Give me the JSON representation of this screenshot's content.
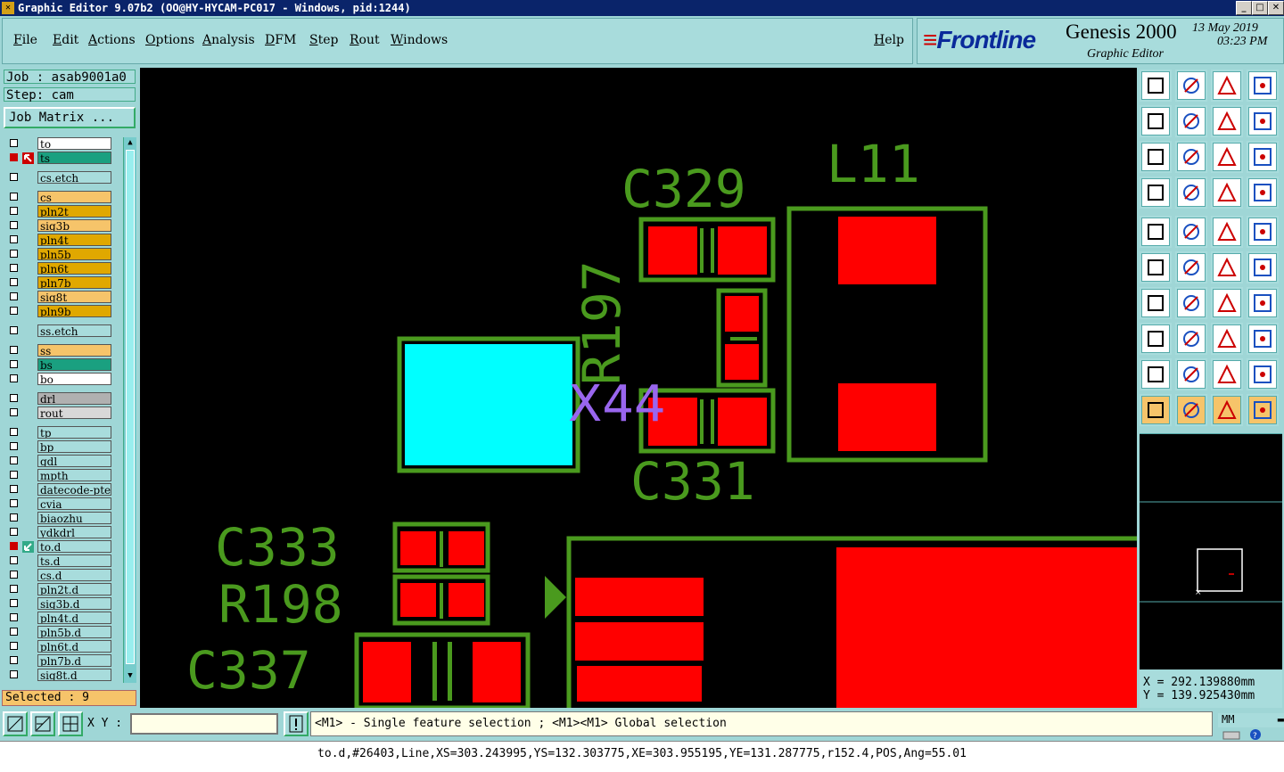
{
  "window": {
    "title": "Graphic Editor 9.07b2 (OO@HY-HYCAM-PC017 - Windows, pid:1244)"
  },
  "menu": [
    "File",
    "Edit",
    "Actions",
    "Options",
    "Analysis",
    "DFM",
    "Step",
    "Rout",
    "Windows"
  ],
  "help_label": "Help",
  "brand": {
    "logo": "Frontline",
    "product": "Genesis 2000",
    "subtitle": "Graphic Editor",
    "date": "13 May 2019",
    "time": "03:23 PM"
  },
  "job": {
    "label": "Job : asab9001a0",
    "step": "Step: cam",
    "matrix_button": "Job Matrix ..."
  },
  "layers": [
    {
      "name": "to",
      "color": "#ffffff",
      "checked": false
    },
    {
      "name": "ts",
      "color": "#1aa080",
      "checked": true,
      "active": true
    },
    {
      "name": "cs.etch",
      "color": "#a8dcdc",
      "checked": false
    },
    {
      "name": "cs",
      "color": "#f6c46a",
      "checked": false
    },
    {
      "name": "pln2t",
      "color": "#e0a800",
      "checked": false
    },
    {
      "name": "sig3b",
      "color": "#f6c46a",
      "checked": false
    },
    {
      "name": "pln4t",
      "color": "#e0a800",
      "checked": false
    },
    {
      "name": "pln5b",
      "color": "#e0a800",
      "checked": false
    },
    {
      "name": "pln6t",
      "color": "#e0a800",
      "checked": false
    },
    {
      "name": "pln7b",
      "color": "#e0a800",
      "checked": false
    },
    {
      "name": "sig8t",
      "color": "#f6c46a",
      "checked": false
    },
    {
      "name": "pln9b",
      "color": "#e0a800",
      "checked": false
    },
    {
      "name": "ss.etch",
      "color": "#a8dcdc",
      "checked": false
    },
    {
      "name": "ss",
      "color": "#f6c46a",
      "checked": false
    },
    {
      "name": "bs",
      "color": "#1aa080",
      "checked": false
    },
    {
      "name": "bo",
      "color": "#ffffff",
      "checked": false
    },
    {
      "name": "drl",
      "color": "#b0b0b0",
      "checked": false
    },
    {
      "name": "rout",
      "color": "#d8d8d8",
      "checked": false
    },
    {
      "name": "tp",
      "color": "#a8dcdc",
      "checked": false
    },
    {
      "name": "bp",
      "color": "#a8dcdc",
      "checked": false
    },
    {
      "name": "gdl",
      "color": "#a8dcdc",
      "checked": false
    },
    {
      "name": "mpth",
      "color": "#a8dcdc",
      "checked": false
    },
    {
      "name": "datecode-pte",
      "color": "#a8dcdc",
      "checked": false
    },
    {
      "name": "cvia",
      "color": "#a8dcdc",
      "checked": false
    },
    {
      "name": "biaozhu",
      "color": "#a8dcdc",
      "checked": false
    },
    {
      "name": "ydkdrl",
      "color": "#a8dcdc",
      "checked": false
    },
    {
      "name": "to.d",
      "color": "#a8dcdc",
      "checked": true,
      "affected": true
    },
    {
      "name": "ts.d",
      "color": "#a8dcdc",
      "checked": false
    },
    {
      "name": "cs.d",
      "color": "#a8dcdc",
      "checked": false
    },
    {
      "name": "pln2t.d",
      "color": "#a8dcdc",
      "checked": false
    },
    {
      "name": "sig3b.d",
      "color": "#a8dcdc",
      "checked": false
    },
    {
      "name": "pln4t.d",
      "color": "#a8dcdc",
      "checked": false
    },
    {
      "name": "pln5b.d",
      "color": "#a8dcdc",
      "checked": false
    },
    {
      "name": "pln6t.d",
      "color": "#a8dcdc",
      "checked": false
    },
    {
      "name": "pln7b.d",
      "color": "#a8dcdc",
      "checked": false
    },
    {
      "name": "sig8t.d",
      "color": "#a8dcdc",
      "checked": false
    }
  ],
  "selected_label": "Selected : 9",
  "canvas_labels": {
    "c329": "C329",
    "l11": "L11",
    "r197": "R197",
    "x44": "X44",
    "c331": "C331",
    "c333": "C333",
    "r198": "R198",
    "c337": "C337"
  },
  "coords": {
    "x": "X = 292.139880mm",
    "y": "Y = 139.925430mm"
  },
  "xy_label": "X Y :",
  "prompt": "<M1> - Single feature selection ; <M1><M1> Global selection",
  "units": "MM",
  "status": "to.d,#26403,Line,XS=303.243995,YS=132.303775,XE=303.955195,YE=131.287775,r152.4,POS,Ang=55.01",
  "colors": {
    "silk": "#4a9a1e",
    "pad": "#ff0000",
    "highlight": "#00ffff",
    "label": "#9966ee"
  }
}
